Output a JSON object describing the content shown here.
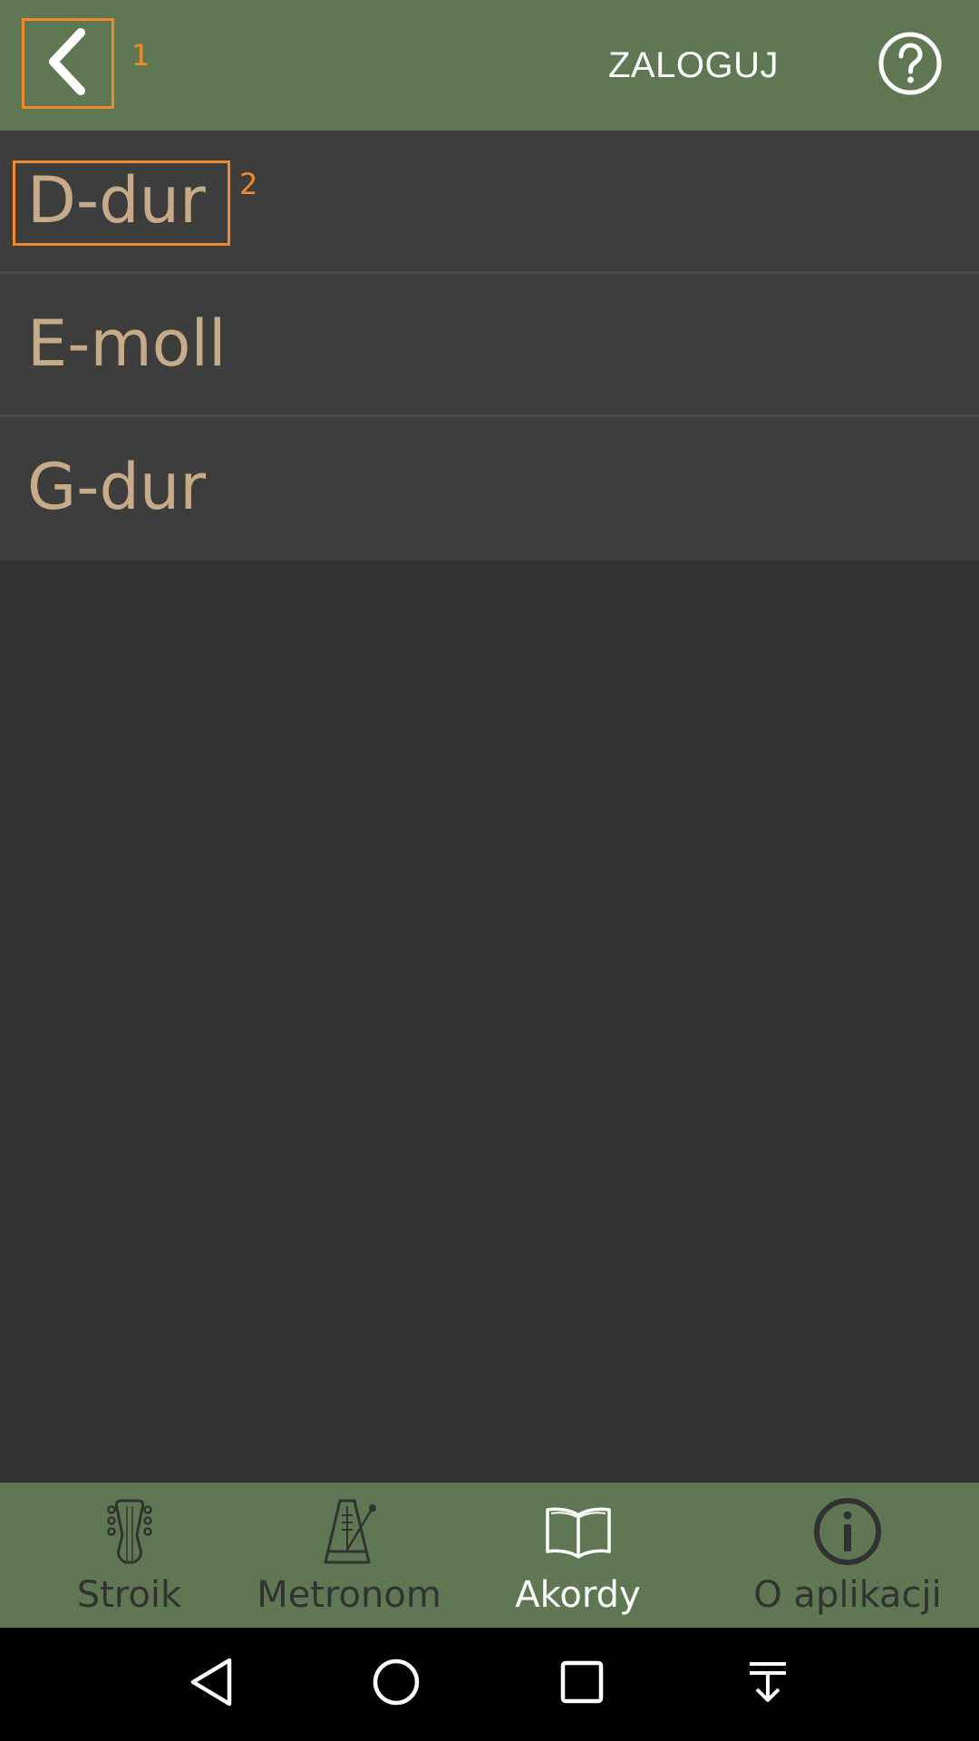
{
  "topbar": {
    "back_icon": "chevron-left-icon",
    "back_marker": "1",
    "login_label": "ZALOGUJ",
    "help_icon": "question-circle-icon"
  },
  "chords": {
    "marker": "2",
    "items": [
      {
        "label": "D-dur"
      },
      {
        "label": "E-moll"
      },
      {
        "label": "G-dur"
      }
    ]
  },
  "bottom_nav": {
    "items": [
      {
        "label": "Stroik",
        "icon": "guitar-headstock-icon",
        "active": false
      },
      {
        "label": "Metronom",
        "icon": "metronome-icon",
        "active": false
      },
      {
        "label": "Akordy",
        "icon": "open-book-icon",
        "active": true
      },
      {
        "label": "O aplikacji",
        "icon": "info-icon",
        "active": false
      }
    ]
  },
  "system_nav": {
    "icons": [
      "back-triangle-icon",
      "home-circle-icon",
      "recents-square-icon",
      "notifications-pulldown-icon"
    ]
  },
  "colors": {
    "toolbar": "#5f7853",
    "background": "#323232",
    "list_item": "#3d3d3d",
    "chord_text": "#c7ab88",
    "annotation": "#f08a2c",
    "inactive_nav": "#323232",
    "active_nav": "#ffffff"
  }
}
